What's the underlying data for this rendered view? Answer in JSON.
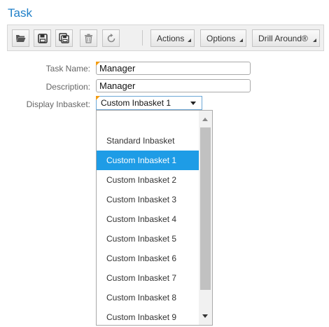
{
  "window": {
    "title": "Task"
  },
  "toolbar": {
    "icons": [
      "open-folder-icon",
      "save-icon",
      "save-as-icon",
      "delete-icon",
      "refresh-icon"
    ],
    "actions_label": "Actions",
    "options_label": "Options",
    "drill_label": "Drill Around®"
  },
  "form": {
    "task_name_label": "Task Name:",
    "task_name_value": "Manager",
    "description_label": "Description:",
    "description_value": "Manager",
    "inbasket_label": "Display Inbasket:",
    "inbasket_value": "Custom Inbasket 1"
  },
  "dropdown": {
    "options": [
      "",
      "Standard Inbasket",
      "Custom Inbasket 1",
      "Custom Inbasket 2",
      "Custom Inbasket 3",
      "Custom Inbasket 4",
      "Custom Inbasket 5",
      "Custom Inbasket 6",
      "Custom Inbasket 7",
      "Custom Inbasket 8",
      "Custom Inbasket 9"
    ],
    "selected": "Custom Inbasket 1"
  },
  "colors": {
    "accent": "#1e9ce6",
    "title": "#1f7fc8",
    "required_marker": "#f39c12"
  }
}
